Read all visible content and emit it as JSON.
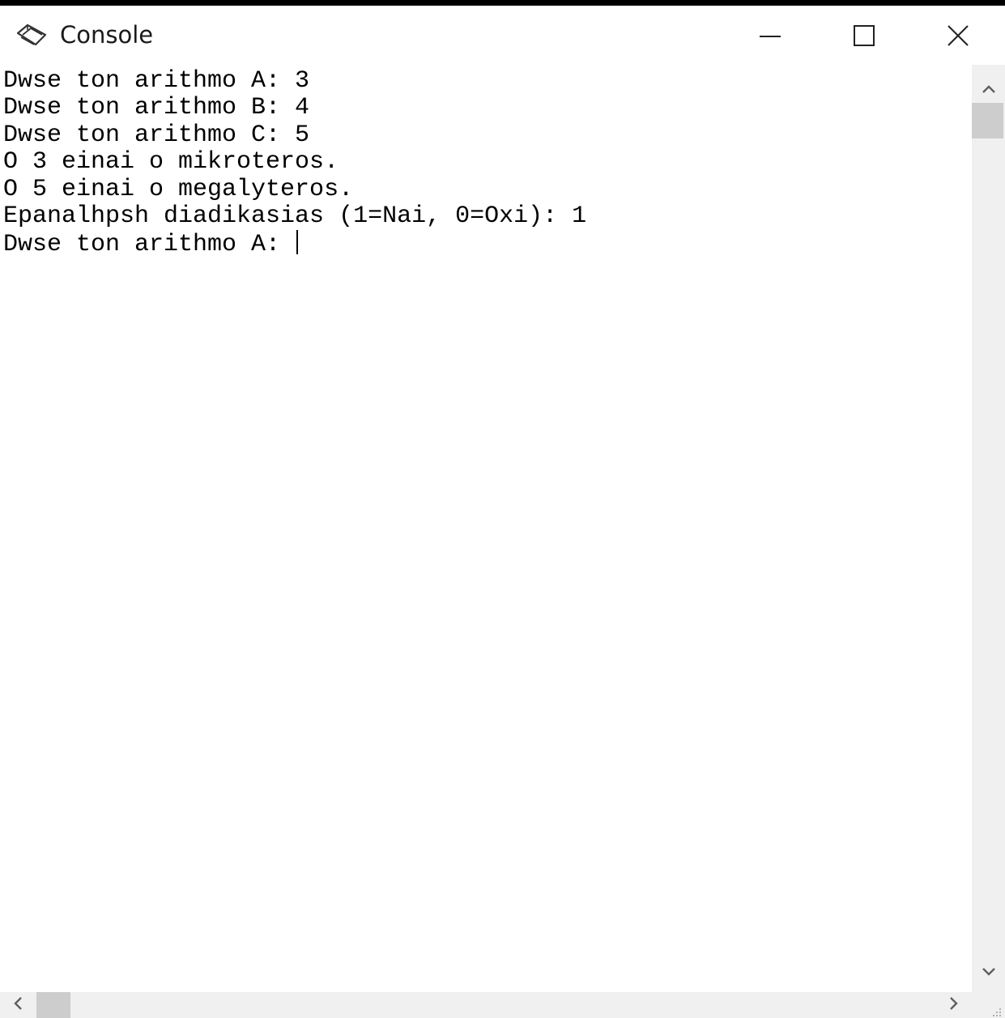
{
  "window": {
    "title": "Console",
    "icon": "console-book-icon",
    "controls": {
      "minimize_icon": "minimize-icon",
      "maximize_icon": "maximize-icon",
      "close_icon": "close-icon"
    }
  },
  "console": {
    "lines": [
      "Dwse ton arithmo A: 3",
      "Dwse ton arithmo B: 4",
      "Dwse ton arithmo C: 5",
      "O 3 einai o mikroteros.",
      "O 5 einai o megalyteros.",
      "Epanalhpsh diadikasias (1=Nai, 0=Oxi): 1",
      "Dwse ton arithmo A: "
    ],
    "text_color": "#000000",
    "background_color": "#ffffff"
  },
  "scrollbars": {
    "vertical": {
      "up_icon": "chevron-up-icon",
      "down_icon": "chevron-down-icon"
    },
    "horizontal": {
      "left_icon": "chevron-left-icon",
      "right_icon": "chevron-right-icon"
    }
  }
}
